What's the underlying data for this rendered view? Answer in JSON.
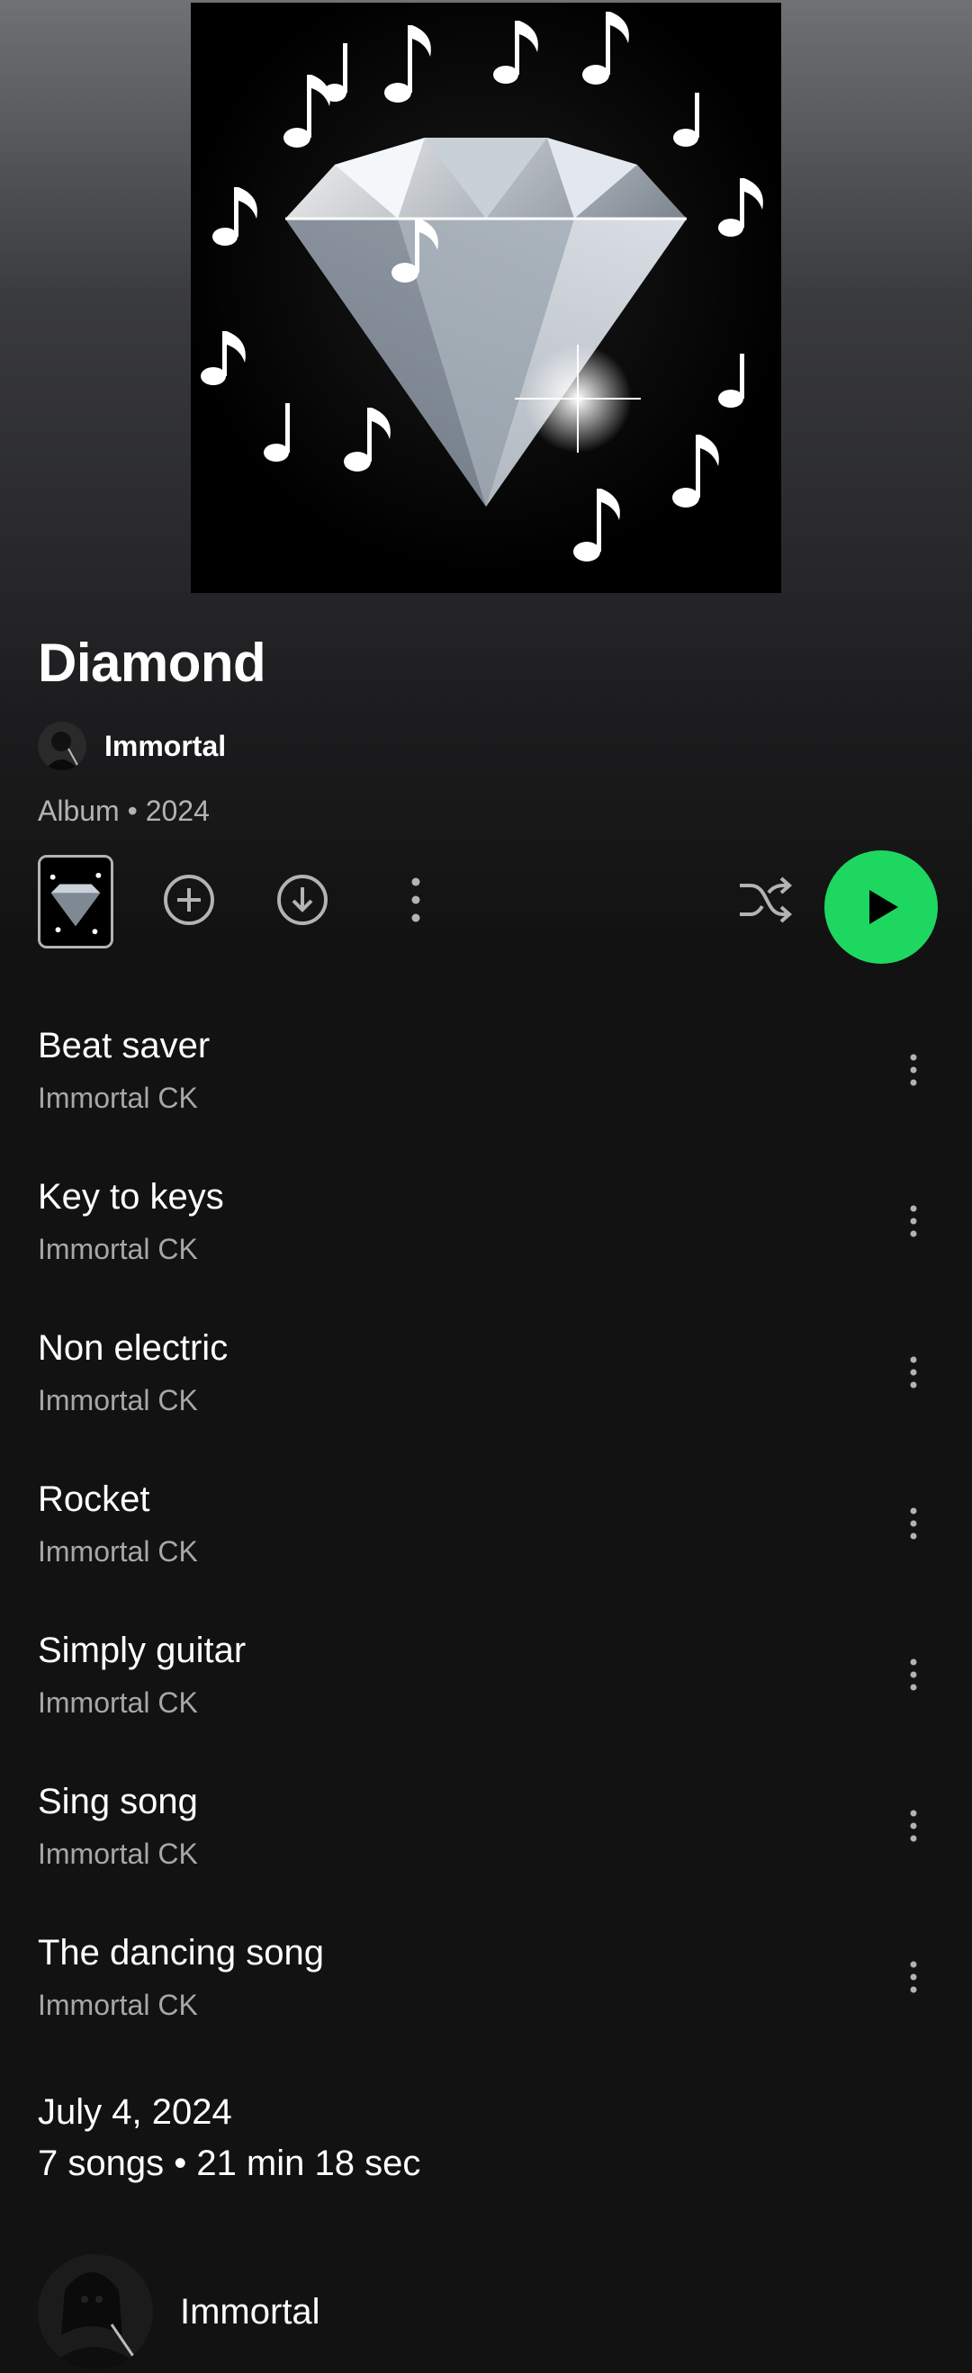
{
  "album": {
    "title": "Diamond",
    "artist": "Immortal",
    "meta": "Album • 2024"
  },
  "actions": {
    "add_icon": "plus-circle-icon",
    "download_icon": "download-circle-icon",
    "more_icon": "vertical-dots-icon",
    "shuffle_icon": "shuffle-icon",
    "play_icon": "play-icon",
    "accent_color": "#1ed760"
  },
  "tracks": [
    {
      "title": "Beat saver",
      "artist": "Immortal CK"
    },
    {
      "title": "Key to keys",
      "artist": "Immortal CK"
    },
    {
      "title": "Non electric",
      "artist": "Immortal CK"
    },
    {
      "title": "Rocket",
      "artist": "Immortal CK"
    },
    {
      "title": "Simply guitar",
      "artist": "Immortal CK"
    },
    {
      "title": "Sing song",
      "artist": "Immortal CK"
    },
    {
      "title": "The dancing song",
      "artist": "Immortal CK"
    }
  ],
  "footer": {
    "release_date": "July 4, 2024",
    "summary": "7 songs • 21 min 18 sec",
    "artist_name": "Immortal"
  }
}
